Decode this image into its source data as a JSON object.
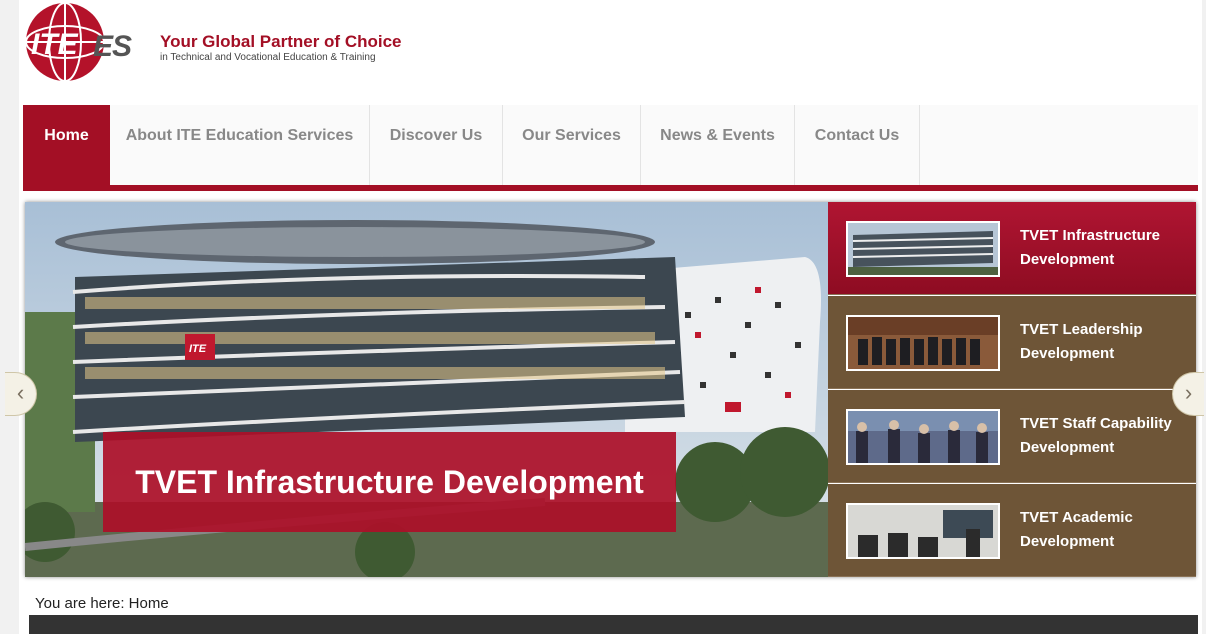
{
  "header": {
    "logo_text": "ITEES",
    "tagline": "Your Global Partner of Choice",
    "subtagline": "in Technical and Vocational Education & Training"
  },
  "nav": {
    "items": [
      {
        "label": "Home",
        "active": true
      },
      {
        "label": "About ITE Education Services",
        "active": false
      },
      {
        "label": "Discover Us",
        "active": false
      },
      {
        "label": "Our Services",
        "active": false
      },
      {
        "label": "News & Events",
        "active": false
      },
      {
        "label": "Contact Us",
        "active": false
      }
    ]
  },
  "slider": {
    "caption": "TVET Infrastructure Development",
    "building_sign": "ITE",
    "thumbnails": [
      {
        "label": "TVET Infrastructure Development",
        "active": true
      },
      {
        "label": "TVET Leadership Development",
        "active": false
      },
      {
        "label": "TVET Staff Capability Development",
        "active": false
      },
      {
        "label": "TVET Academic Development",
        "active": false
      }
    ],
    "prev_icon": "chevron-left-icon",
    "next_icon": "chevron-right-icon"
  },
  "breadcrumb": {
    "text": "You are here: Home"
  },
  "colors": {
    "brand": "#a30f25",
    "thumb_bg": "#6e5537"
  }
}
